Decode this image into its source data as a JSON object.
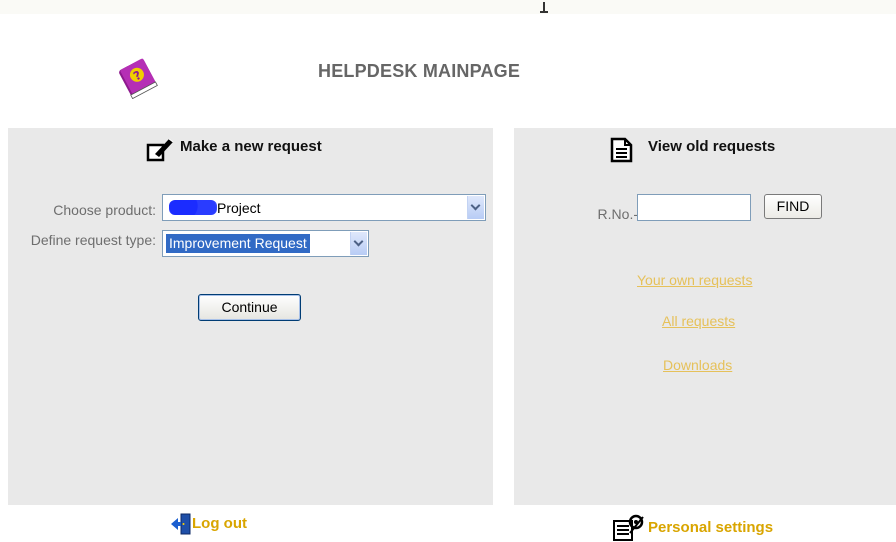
{
  "page": {
    "title": "HELPDESK MAINPAGE"
  },
  "new_request": {
    "heading": "Make a new request",
    "product_label": "Choose product:",
    "product_value": "Project",
    "type_label": "Define request type:",
    "type_value": "Improvement Request",
    "continue_label": "Continue"
  },
  "old_requests": {
    "heading": "View old requests",
    "rno_label": "R.No.-",
    "rno_value": "",
    "find_label": "FIND",
    "links": {
      "own": "Your own requests",
      "all": "All requests",
      "downloads": "Downloads"
    }
  },
  "footer": {
    "logout": "Log out",
    "settings": "Personal settings"
  },
  "colors": {
    "panel_bg": "#e9e9e9",
    "link": "#e6c15a",
    "footer_link": "#d9a500",
    "title": "#666666"
  },
  "icons": {
    "logo": "help-book-icon",
    "new_request": "pencil-edit-icon",
    "old_requests": "document-icon",
    "logout": "exit-door-icon",
    "settings": "settings-clipboard-icon"
  }
}
